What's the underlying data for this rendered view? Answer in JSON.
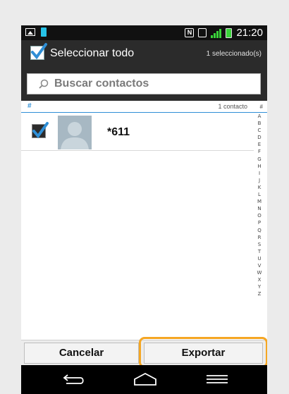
{
  "status_bar": {
    "time": "21:20",
    "left_icons": [
      "image-icon",
      "battery-saver-icon"
    ],
    "right_icons": [
      "nfc-icon",
      "vibrate-icon",
      "hplus-signal-icon",
      "battery-icon"
    ]
  },
  "action_bar": {
    "select_all_label": "Seleccionar todo",
    "selected_count": "1 seleccionado(s)",
    "select_all_checked": true
  },
  "search": {
    "placeholder": "Buscar contactos"
  },
  "list_header": {
    "section": "#",
    "count": "1 contacto"
  },
  "contacts": [
    {
      "name": "*611",
      "checked": true
    }
  ],
  "alphabet_index": [
    "#",
    "A",
    "B",
    "C",
    "D",
    "E",
    "F",
    "G",
    "H",
    "I",
    "J",
    "K",
    "L",
    "M",
    "N",
    "O",
    "P",
    "Q",
    "R",
    "S",
    "T",
    "U",
    "V",
    "W",
    "X",
    "Y",
    "Z"
  ],
  "buttons": {
    "cancel": "Cancelar",
    "export": "Exportar"
  },
  "colors": {
    "accent": "#2f8fd6",
    "highlight": "#f5a623",
    "signal": "#3ad43a"
  }
}
